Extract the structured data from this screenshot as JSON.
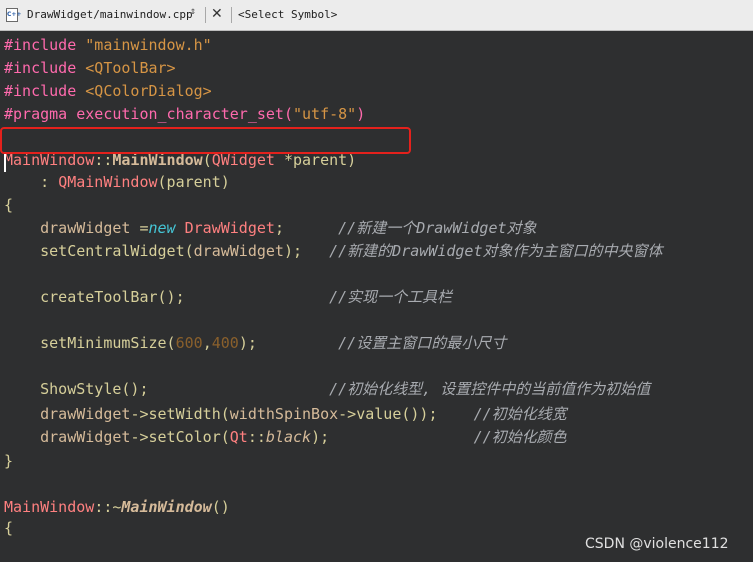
{
  "editor_toolbar": {
    "file_icon": "cpp-file-icon",
    "file_name": "DrawWidget/mainwindow.cpp",
    "updown_glyph": "⇕",
    "close_glyph": "✕",
    "symbol_selector": "<Select Symbol>"
  },
  "code_lines": [
    [
      [
        "pp",
        "#include "
      ],
      [
        "str",
        "\"mainwindow.h\""
      ]
    ],
    [
      [
        "pp",
        "#include "
      ],
      [
        "str",
        "<QToolBar>"
      ]
    ],
    [
      [
        "pp",
        "#include "
      ],
      [
        "str",
        "<QColorDialog>"
      ]
    ],
    [
      [
        "pp",
        "#pragma execution_character_set("
      ],
      [
        "str",
        "\"utf-8\""
      ],
      [
        "pp",
        ")"
      ]
    ],
    [],
    [
      [
        "typ",
        "MainWindow"
      ],
      [
        "op",
        "::"
      ],
      [
        "fn",
        "MainWindow"
      ],
      [
        "op",
        "("
      ],
      [
        "typ",
        "QWidget"
      ],
      [
        "op",
        " *parent)"
      ]
    ],
    [
      [
        "op",
        "    : "
      ],
      [
        "typ",
        "QMainWindow"
      ],
      [
        "op",
        "(parent)"
      ]
    ],
    [
      [
        "op",
        "{"
      ]
    ],
    [
      [
        "op",
        "    "
      ],
      [
        "mem",
        "drawWidget"
      ],
      [
        "op",
        " ="
      ],
      [
        "kw",
        "new"
      ],
      [
        "op",
        " "
      ],
      [
        "typ",
        "DrawWidget"
      ],
      [
        "op",
        ";      "
      ],
      [
        "cmt",
        "//新建一个DrawWidget对象"
      ]
    ],
    [
      [
        "op",
        "    setCentralWidget("
      ],
      [
        "mem",
        "drawWidget"
      ],
      [
        "op",
        ");   "
      ],
      [
        "cmt",
        "//新建的DrawWidget对象作为主窗口的中央窗体"
      ]
    ],
    [],
    [
      [
        "op",
        "    createToolBar();                "
      ],
      [
        "cmt",
        "//实现一个工具栏"
      ]
    ],
    [],
    [
      [
        "op",
        "    setMinimumSize("
      ],
      [
        "num",
        "600"
      ],
      [
        "op",
        ","
      ],
      [
        "num",
        "400"
      ],
      [
        "op",
        ");         "
      ],
      [
        "cmt",
        "//设置主窗口的最小尺寸"
      ]
    ],
    [],
    [
      [
        "op",
        "    ShowStyle();                    "
      ],
      [
        "cmt",
        "//初始化线型, 设置控件中的当前值作为初始值"
      ]
    ],
    [
      [
        "op",
        "    "
      ],
      [
        "mem",
        "drawWidget"
      ],
      [
        "op",
        "->setWidth("
      ],
      [
        "mem",
        "widthSpinBox"
      ],
      [
        "op",
        "->value());    "
      ],
      [
        "cmt",
        "//初始化线宽"
      ]
    ],
    [
      [
        "op",
        "    "
      ],
      [
        "mem",
        "drawWidget"
      ],
      [
        "op",
        "->setColor("
      ],
      [
        "typ",
        "Qt"
      ],
      [
        "op",
        "::"
      ],
      [
        "enumv",
        "black"
      ],
      [
        "op",
        ");                "
      ],
      [
        "cmt",
        "//初始化颜色"
      ]
    ],
    [
      [
        "op",
        "}"
      ]
    ],
    [],
    [
      [
        "typ",
        "MainWindow"
      ],
      [
        "op",
        "::~"
      ],
      [
        "fni",
        "MainWindow"
      ],
      [
        "op",
        "()"
      ]
    ],
    [
      [
        "op",
        "{"
      ]
    ]
  ],
  "line_tops": [
    4,
    27,
    50,
    73,
    96,
    119,
    141,
    164,
    187,
    210,
    235,
    256,
    281,
    302,
    327,
    348,
    373,
    396,
    420,
    444,
    466,
    487
  ],
  "watermark": "CSDN @violence112"
}
